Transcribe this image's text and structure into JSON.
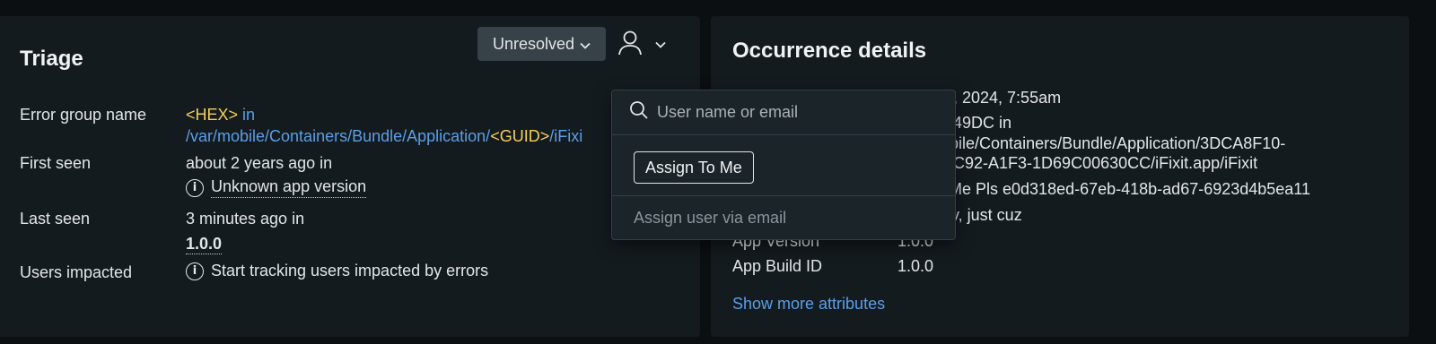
{
  "triage": {
    "title": "Triage",
    "status_label": "Unresolved",
    "rows": {
      "error_group": {
        "label": "Error group name",
        "hex_tag": "<HEX>",
        "in_text": " in",
        "path_prefix": "/var/mobile/Containers/Bundle/Application/",
        "guid_tag": "<GUID>",
        "path_suffix": "/iFixi"
      },
      "first_seen": {
        "label": "First seen",
        "value": "about 2 years ago in",
        "version": "Unknown app version"
      },
      "last_seen": {
        "label": "Last seen",
        "value": "3 minutes ago in",
        "version": "1.0.0"
      },
      "users_impacted": {
        "label": "Users impacted",
        "value": "Start tracking users impacted by errors"
      }
    }
  },
  "occurrence": {
    "title": "Occurrence details",
    "partial_lines": [
      ", 2024, 7:55am",
      "749DC in",
      "obile/Containers/Bundle/Application/3DCA8F10-",
      "C92-A1F3-1D69C00630CC/iFixit.app/iFixit",
      "Me Pls e0d318ed-67eb-418b-ad67-6923d4b5ea11",
      "v, just cuz"
    ],
    "attributes": [
      {
        "key": "App Version",
        "value": "1.0.0"
      },
      {
        "key": "App Build ID",
        "value": "1.0.0"
      }
    ],
    "show_more": "Show more attributes"
  },
  "assign_popover": {
    "search_placeholder": "User name or email",
    "assign_me_label": "Assign To Me",
    "assign_email_label": "Assign user via email"
  },
  "icons": {
    "status_chevron": "chevron-down-icon",
    "assignee": "user-icon",
    "assignee_chevron": "chevron-down-icon",
    "info": "info-icon",
    "search": "search-icon"
  },
  "colors": {
    "background": "#0b0f11",
    "panel": "#141b1f",
    "link_blue": "#5c9ee8",
    "highlight_yellow": "#f6cf5a",
    "dropdown_bg": "#364148"
  }
}
